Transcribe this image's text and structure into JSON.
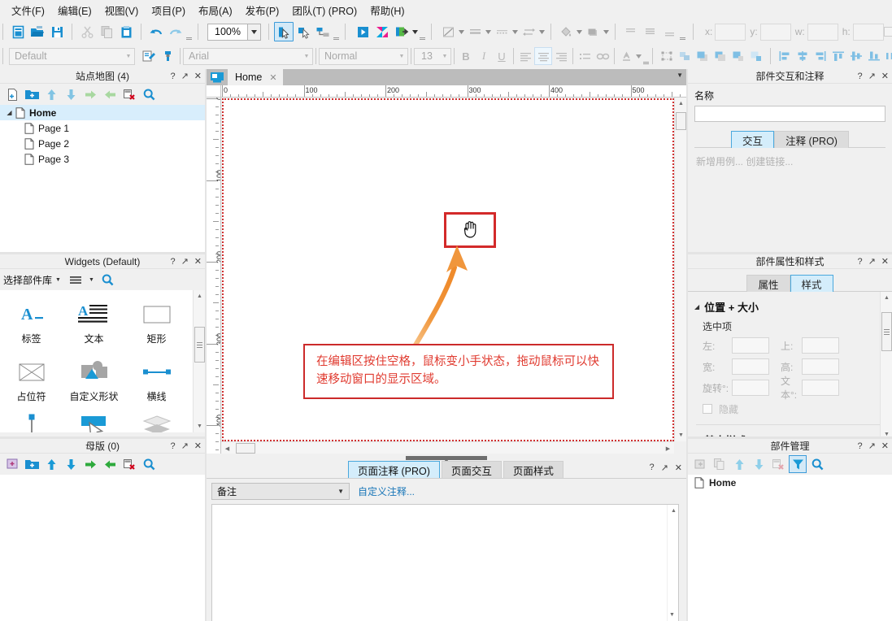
{
  "menubar": {
    "items": [
      {
        "label": "文件(F)",
        "name": "menu-file"
      },
      {
        "label": "编辑(E)",
        "name": "menu-edit"
      },
      {
        "label": "视图(V)",
        "name": "menu-view"
      },
      {
        "label": "项目(P)",
        "name": "menu-project"
      },
      {
        "label": "布局(A)",
        "name": "menu-layout"
      },
      {
        "label": "发布(P)",
        "name": "menu-publish"
      },
      {
        "label": "团队(T) (PRO)",
        "name": "menu-team"
      },
      {
        "label": "帮助(H)",
        "name": "menu-help"
      }
    ]
  },
  "toolbar": {
    "zoom_value": "100%",
    "style_combo": "Default",
    "font_combo": "Arial",
    "weight_combo": "Normal",
    "size_combo": "13",
    "bold": "B",
    "italic": "I",
    "underline": "U",
    "coord_labels": {
      "x": "x:",
      "y": "y:",
      "w": "w:",
      "h": "h:"
    },
    "hidden_label": "隐藏"
  },
  "sitemap": {
    "title": "站点地图 (4)",
    "controls": {
      "help": "?",
      "float": "↗",
      "close": "✕"
    },
    "tools": [
      "add-page-icon",
      "add-folder-icon",
      "move-up-icon",
      "move-down-icon",
      "indent-right-icon",
      "indent-left-icon",
      "delete-icon",
      "search-icon"
    ],
    "tree": [
      {
        "label": "Home",
        "level": 0,
        "selected": true,
        "expanded": true
      },
      {
        "label": "Page 1",
        "level": 1,
        "selected": false
      },
      {
        "label": "Page 2",
        "level": 1,
        "selected": false
      },
      {
        "label": "Page 3",
        "level": 1,
        "selected": false
      }
    ]
  },
  "widgets": {
    "title": "Widgets (Default)",
    "controls": {
      "help": "?",
      "float": "↗",
      "close": "✕"
    },
    "library_label": "选择部件库",
    "items": [
      {
        "label": "标签",
        "icon": "label-widget-icon"
      },
      {
        "label": "文本",
        "icon": "paragraph-widget-icon"
      },
      {
        "label": "矩形",
        "icon": "rectangle-widget-icon"
      },
      {
        "label": "占位符",
        "icon": "placeholder-widget-icon"
      },
      {
        "label": "自定义形状",
        "icon": "custom-shape-widget-icon"
      },
      {
        "label": "横线",
        "icon": "horizontal-line-widget-icon"
      },
      {
        "label": "",
        "icon": "vertical-line-widget-icon"
      },
      {
        "label": "",
        "icon": "button-widget-icon"
      },
      {
        "label": "",
        "icon": "layers-widget-icon"
      }
    ]
  },
  "masters": {
    "title": "母版 (0)",
    "controls": {
      "help": "?",
      "float": "↗",
      "close": "✕"
    },
    "tools": [
      "add-master-icon",
      "add-folder-icon",
      "move-up-icon",
      "move-down-icon",
      "indent-right-icon",
      "indent-left-icon",
      "delete-icon",
      "search-icon"
    ]
  },
  "canvas": {
    "tab_label": "Home",
    "tab_close": "✕",
    "ruler_h": [
      "0",
      "100",
      "200",
      "300",
      "400",
      "500"
    ],
    "ruler_v": [
      "0",
      "100",
      "200",
      "300",
      "400"
    ],
    "note_text": "在编辑区按住空格，鼠标变小手状态，拖动鼠标可以快速移动窗口的显示区域。",
    "hand_icon": "hand-cursor-icon",
    "arrow_icon": "curved-arrow-icon",
    "colors": {
      "note_border": "#cc2a2a",
      "note_text": "#e03a2f",
      "arrow": "#f0963c",
      "page_border": "#cf3030"
    }
  },
  "bottom_dock": {
    "controls": {
      "help": "?",
      "float": "↗",
      "close": "✕"
    },
    "tabs": [
      {
        "label": "页面注释 (PRO)",
        "active": true
      },
      {
        "label": "页面交互",
        "active": false
      },
      {
        "label": "页面样式",
        "active": false
      }
    ],
    "note_select": "备注",
    "custom_note_link": "自定义注释..."
  },
  "interactions_panel": {
    "title": "部件交互和注释",
    "controls": {
      "help": "?",
      "float": "↗",
      "close": "✕"
    },
    "name_label": "名称",
    "name_value": "",
    "tabs": [
      {
        "label": "交互",
        "active": true
      },
      {
        "label": "注释 (PRO)",
        "active": false
      }
    ],
    "links": "新增用例... 创建链接..."
  },
  "properties_panel": {
    "title": "部件属性和样式",
    "controls": {
      "help": "?",
      "float": "↗",
      "close": "✕"
    },
    "tabs": [
      {
        "label": "属性",
        "active": false
      },
      {
        "label": "样式",
        "active": true
      }
    ],
    "section_position": "位置 + 大小",
    "selected_label": "选中项",
    "fields": [
      {
        "label": "左:",
        "value": ""
      },
      {
        "label": "上:",
        "value": ""
      },
      {
        "label": "宽:",
        "value": ""
      },
      {
        "label": "高:",
        "value": ""
      },
      {
        "label": "旋转°:",
        "value": ""
      },
      {
        "label": "文本°:",
        "value": ""
      }
    ],
    "hidden_label": "隐藏",
    "section_basic": "基本样式"
  },
  "widget_manager": {
    "title": "部件管理",
    "controls": {
      "help": "?",
      "float": "↗",
      "close": "✕"
    },
    "tools": [
      "add-icon",
      "duplicate-icon",
      "move-up-icon",
      "move-down-icon",
      "delete-icon",
      "filter-icon",
      "search-icon"
    ],
    "items": [
      {
        "label": "Home"
      }
    ]
  }
}
